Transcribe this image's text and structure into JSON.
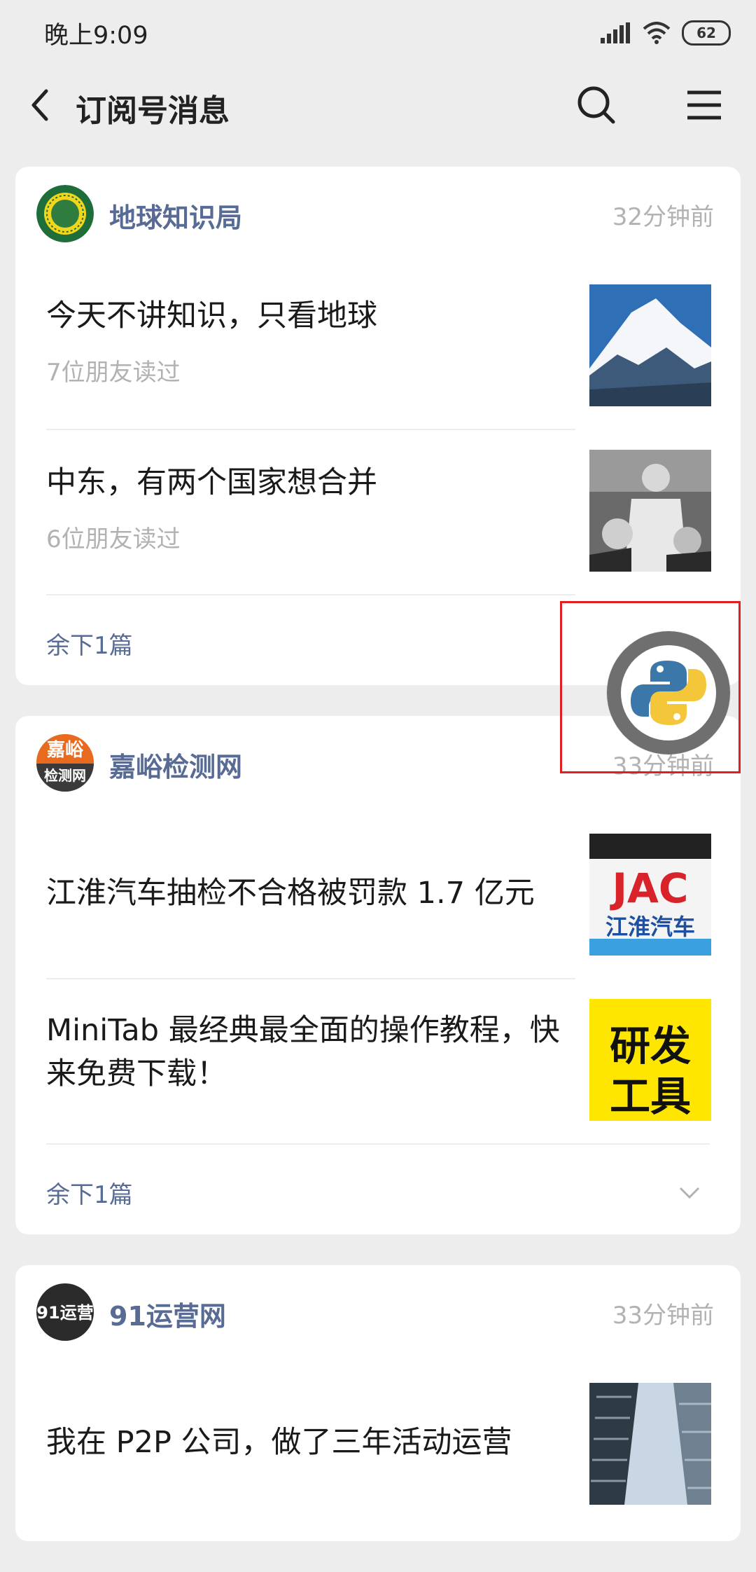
{
  "status_bar": {
    "time": "晚上9:09",
    "battery": "62"
  },
  "nav": {
    "title": "订阅号消息"
  },
  "cards": [
    {
      "account": "地球知识局",
      "time": "32分钟前",
      "articles": [
        {
          "title": "今天不讲知识，只看地球",
          "sub": "7位朋友读过"
        },
        {
          "title": "中东，有两个国家想合并",
          "sub": "6位朋友读过"
        }
      ],
      "more": "余下1篇"
    },
    {
      "account": "嘉峪检测网",
      "avatar_text_top": "嘉峪",
      "avatar_text_bottom": "检测网",
      "time": "33分钟前",
      "articles": [
        {
          "title": "江淮汽车抽检不合格被罚款 1.7 亿元",
          "thumb_top": "JAC",
          "thumb_bottom": "江淮汽车"
        },
        {
          "title": "MiniTab 最经典最全面的操作教程，快来免费下载！",
          "thumb_top": "研发",
          "thumb_bottom": "工具"
        }
      ],
      "more": "余下1篇"
    },
    {
      "account": "91运营网",
      "avatar_text": "91运营",
      "time": "33分钟前",
      "articles": [
        {
          "title": "我在 P2P 公司，做了三年活动运营"
        }
      ]
    }
  ],
  "colors": {
    "accent_link": "#576b95",
    "highlight_box": "#e02020"
  }
}
